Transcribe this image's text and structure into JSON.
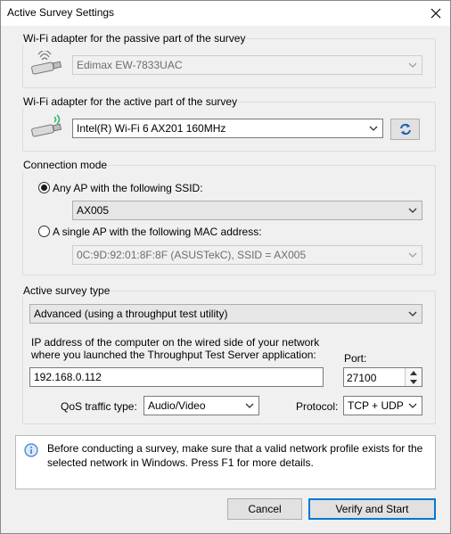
{
  "window": {
    "title": "Active Survey Settings"
  },
  "passive": {
    "label": "Wi-Fi adapter for the passive part of the survey",
    "adapter": "Edimax EW-7833UAC"
  },
  "active": {
    "label": "Wi-Fi adapter for the active part of the survey",
    "adapter": "Intel(R) Wi-Fi 6 AX201 160MHz"
  },
  "connection": {
    "label": "Connection mode",
    "any_ap_label": "Any AP with the following SSID:",
    "ssid_value": "AX005",
    "single_ap_label": "A single AP with the following MAC address:",
    "mac_value": "0C:9D:92:01:8F:8F  (ASUSTekC), SSID = AX005"
  },
  "survey_type": {
    "label": "Active survey type",
    "value": "Advanced (using a throughput test utility)",
    "ip_label_line1": "IP address of the computer on the wired side of your network",
    "ip_label_line2": "where you launched the Throughput Test Server application:",
    "ip_value": "192.168.0.112",
    "port_label": "Port:",
    "port_value": "27100",
    "qos_label": "QoS traffic type:",
    "qos_value": "Audio/Video",
    "protocol_label": "Protocol:",
    "protocol_value": "TCP + UDP"
  },
  "info": {
    "text": "Before conducting a survey, make sure that a valid network profile exists for the selected network in Windows. Press F1 for more details."
  },
  "buttons": {
    "cancel": "Cancel",
    "verify": "Verify and Start"
  },
  "colors": {
    "accent": "#0078d7",
    "info_icon": "#3a7ed6",
    "adapter_signal": "#3cb371"
  }
}
